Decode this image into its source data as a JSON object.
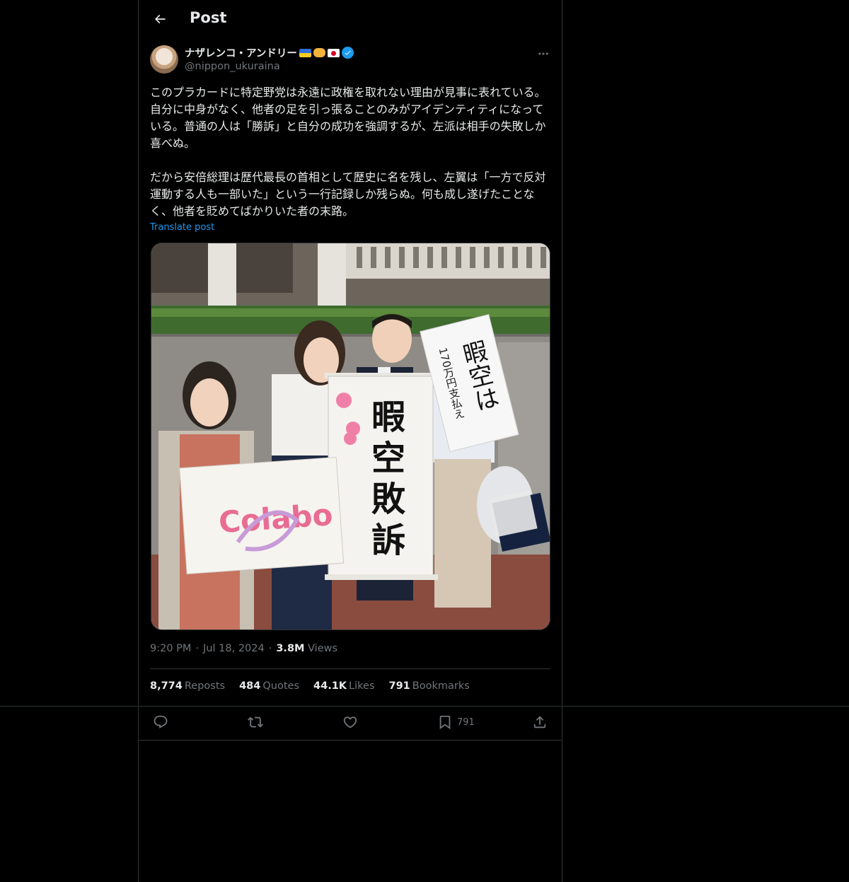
{
  "header": {
    "title": "Post"
  },
  "author": {
    "display_name": "ナザレンコ・アンドリー",
    "handle": "@nippon_ukuraina",
    "badges": [
      "ukraine-flag",
      "handshake-emoji",
      "japan-flag",
      "verified-badge"
    ]
  },
  "post": {
    "text": "このプラカードに特定野党は永遠に政権を取れない理由が見事に表れている。自分に中身がなく、他者の足を引っ張ることのみがアイデンティティになっている。普通の人は「勝訴」と自分の成功を強調するが、左派は相手の失敗しか喜べぬ。\n\nだから安倍総理は歴代最長の首相として歴史に名を残し、左翼は「一方で反対運動する人も一部いた」という一行記録しか残らぬ。何も成し遂げたことなく、他者を貶めてばかりいた者の末路。",
    "translate_label": "Translate post"
  },
  "photo": {
    "banner_center": "暇空敗訴",
    "banner_right_main": "暇空は",
    "banner_right_sub": "170万円支払え",
    "banner_left": "Colabo"
  },
  "meta": {
    "time": "9:20 PM",
    "date": "Jul 18, 2024",
    "views_count": "3.8M",
    "views_label": "Views"
  },
  "stats": [
    {
      "count": "8,774",
      "label": "Reposts"
    },
    {
      "count": "484",
      "label": "Quotes"
    },
    {
      "count": "44.1K",
      "label": "Likes"
    },
    {
      "count": "791",
      "label": "Bookmarks"
    }
  ],
  "actions": {
    "bookmark_count": "791"
  },
  "colors": {
    "background": "#000000",
    "text": "#e7e9ea",
    "muted": "#71767b",
    "accent": "#1d9bf0",
    "border": "#2f3336"
  }
}
